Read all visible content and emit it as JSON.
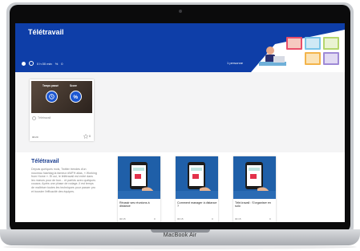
{
  "device": {
    "brand": "MacBook Air"
  },
  "header": {
    "title": "Télétravail",
    "time": "0 h 00 min",
    "score": "0",
    "participants": "1 personne"
  },
  "module_card": {
    "time_spent_label": "Temps passé",
    "score_label": "Score",
    "subtitle": "Télétravail",
    "duration": "00:20",
    "likes": "0"
  },
  "section": {
    "title": "Télétravail",
    "description": "Depuis quelques mois, Twitter trendes d'un nouveau hashtag la fameux #WFH alias, « Working from Home ». Et oui, le télétravail est entré dans les mœurs pour de bon... et parfois avec quelques couacs. Après une phase de rodage, il est temps de maîtriser toutes les techniques pour passer pro et booster l'efficacité des équipes."
  },
  "cards": [
    {
      "title": "Réussir ses réunions à distance",
      "duration": "00:15",
      "likes": "0"
    },
    {
      "title": "Comment manager à distance ?",
      "duration": "00:15",
      "likes": "0"
    },
    {
      "title": "Télé-travail : S'organiser en solo",
      "duration": "00:15",
      "likes": "0"
    }
  ],
  "colors": {
    "header": "#0e3ea8",
    "accent": "#1c57d1",
    "card_image": "#1f5fa8"
  }
}
